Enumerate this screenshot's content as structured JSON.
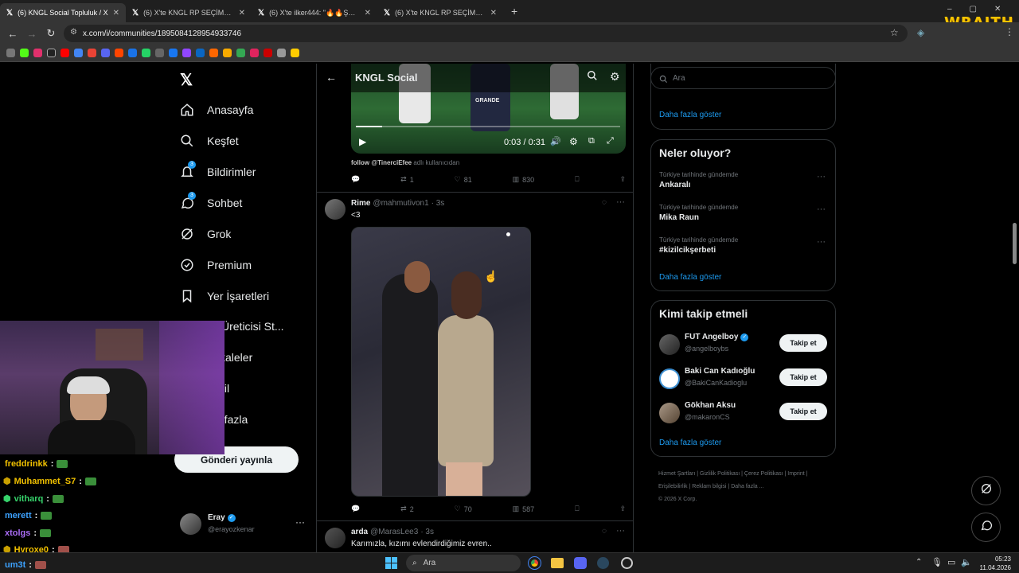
{
  "browser": {
    "tabs": [
      {
        "title": "(6) KNGL Social Topluluk / X",
        "active": true
      },
      {
        "title": "(6) X'te KNGL RP SEÇİMLERİ: \"",
        "active": false
      },
      {
        "title": "(6) X'te ilker444: \"🔥🔥ŞEHMU",
        "active": false
      },
      {
        "title": "(6) X'te KNGL RP SEÇİMLERİ: \"3",
        "active": false
      }
    ],
    "new_tab": "+",
    "url": "x.com/i/communities/1895084128954933746"
  },
  "overlay": {
    "logo_text": "WRAITH"
  },
  "sidebar": {
    "items": [
      {
        "label": "Anasayfa",
        "icon": "home-icon"
      },
      {
        "label": "Keşfet",
        "icon": "search-icon"
      },
      {
        "label": "Bildirimler",
        "icon": "bell-icon",
        "badge": "3"
      },
      {
        "label": "Sohbet",
        "icon": "chat-icon",
        "badge": "3"
      },
      {
        "label": "Grok",
        "icon": "grok-icon"
      },
      {
        "label": "Premium",
        "icon": "premium-icon"
      },
      {
        "label": "Yer İşaretleri",
        "icon": "bookmark-icon"
      },
      {
        "label": "ik Üreticisi St...",
        "icon": "creator-icon"
      },
      {
        "label": "kaleler",
        "icon": "articles-icon"
      },
      {
        "label": "fil",
        "icon": "profile-icon"
      },
      {
        "label": "a fazla",
        "icon": "more-icon"
      }
    ],
    "post_button": "Gönderi yayınla",
    "account": {
      "name": "Eray",
      "handle": "@erayozkenar"
    }
  },
  "feed": {
    "header_title": "KNGL Social",
    "video": {
      "time": "0:03 / 0:31",
      "jersey_text": "GRANDE"
    },
    "prev_post": {
      "caption_bold": "follow @TinerciEfee",
      "caption_rest": " adlı kullanıcıdan",
      "retweets": "1",
      "likes": "81",
      "views": "830"
    },
    "post": {
      "name": "Rime",
      "handle": "@mahmutivon1",
      "time": "· 3s",
      "text": "<3",
      "retweets": "2",
      "likes": "70",
      "views": "587"
    },
    "next_post": {
      "name": "arda",
      "handle": "@MarasLee3",
      "time": "· 3s",
      "text": "Karımızla, kızımı evlendirdiğimiz evren.."
    }
  },
  "right": {
    "search_placeholder": "Ara",
    "show_more": "Daha fazla göster",
    "trends_title": "Neler oluyor?",
    "trends": [
      {
        "context": "Türkiye tarihinde gündemde",
        "name": "Ankaralı"
      },
      {
        "context": "Türkiye tarihinde gündemde",
        "name": "Mika Raun"
      },
      {
        "context": "Türkiye tarihinde gündemde",
        "name": "#kizilcikşerbeti"
      }
    ],
    "who_title": "Kimi takip etmeli",
    "who": [
      {
        "name": "FUT Angelboy",
        "handle": "@angelboybs",
        "verified": true
      },
      {
        "name": "Baki Can Kadıoğlu",
        "handle": "@BakiCanKadioglu",
        "verified": false
      },
      {
        "name": "Gökhan Aksu",
        "handle": "@makaronCS",
        "verified": false
      }
    ],
    "follow_label": "Takip et",
    "footer_links": [
      "Hizmet Şartları",
      "Gizlilik Politikası",
      "Çerez Politikası",
      "Imprint",
      "Erişilebilirlik",
      "Reklam bilgisi",
      "Daha fazla ..."
    ],
    "copyright": "© 2026 X Corp."
  },
  "chat": [
    {
      "user": "freddrinkk",
      "color": "#f0c000"
    },
    {
      "user": "Muhammet_S7",
      "color": "#f0c000"
    },
    {
      "user": "vitharq",
      "color": "#36d36b"
    },
    {
      "user": "merett",
      "color": "#3da2ff"
    },
    {
      "user": "xtolgs",
      "color": "#a96cf5"
    },
    {
      "user": "Hyroxe0",
      "color": "#f0c000"
    },
    {
      "user": "um3t",
      "color": "#3da2ff"
    }
  ],
  "taskbar": {
    "search": "Ara",
    "time": "05:23",
    "date": "11.04.2026"
  },
  "colors": {
    "accent": "#1d9bf0",
    "border": "#2f3336",
    "muted": "#71767b"
  }
}
